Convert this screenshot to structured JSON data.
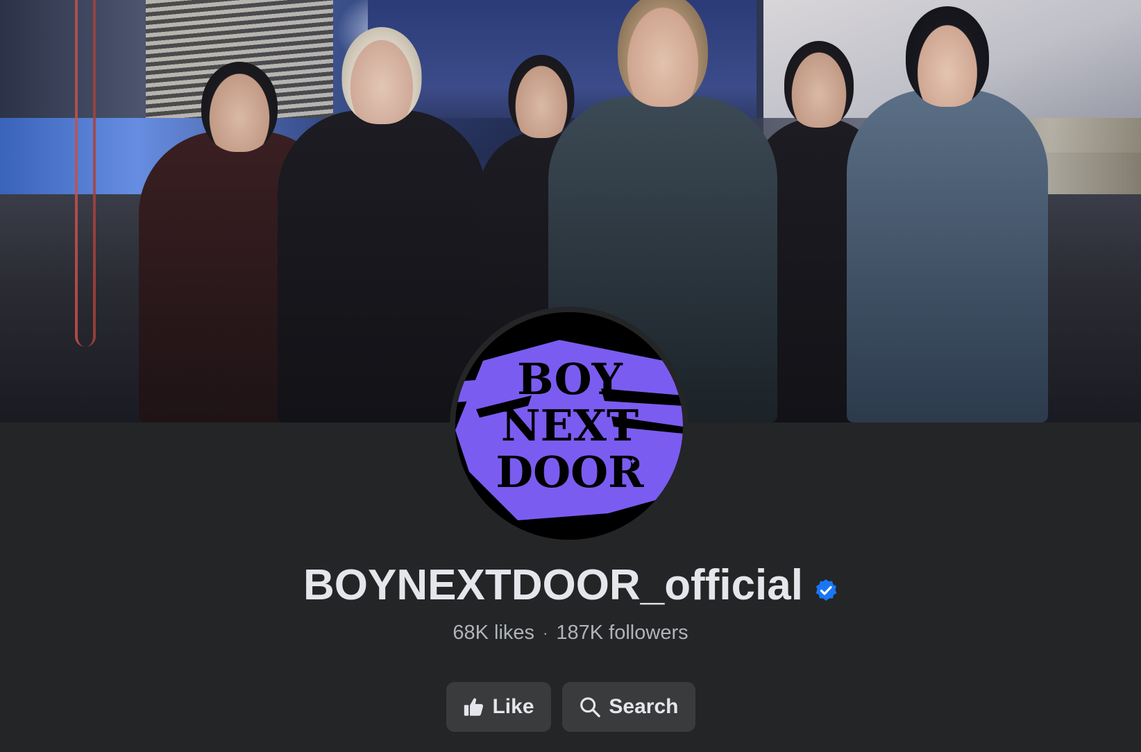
{
  "cover": {
    "image_name": "cover-photo"
  },
  "avatar": {
    "image_name": "boynextdoor-logo-avatar",
    "accent_color": "#7b5cf0"
  },
  "profile": {
    "name": "BOYNEXTDOOR_official",
    "verified": true,
    "verified_color": "#1877f2",
    "likes": "68K likes",
    "separator": "·",
    "followers": "187K followers"
  },
  "actions": {
    "like_label": "Like",
    "like_icon": "thumbs-up-icon",
    "search_label": "Search",
    "search_icon": "search-icon"
  }
}
